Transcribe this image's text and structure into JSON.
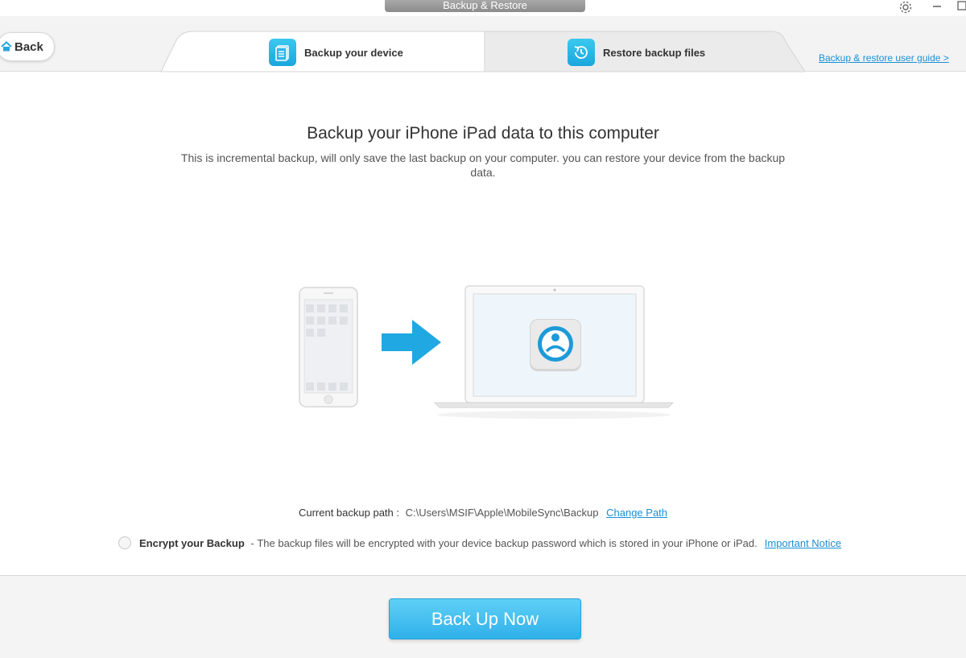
{
  "window": {
    "title": "Backup & Restore"
  },
  "header": {
    "back_label": "Back",
    "tabs": [
      {
        "label": "Backup your device",
        "icon": "backup-document-icon",
        "active": true
      },
      {
        "label": "Restore backup files",
        "icon": "restore-history-icon",
        "active": false
      }
    ],
    "guide_link": "Backup & restore user guide >"
  },
  "main": {
    "title": "Backup your iPhone iPad data to this computer",
    "description": "This is incremental backup, will only save the last backup on your computer. you can restore your device from the backup data."
  },
  "backup_path": {
    "label": "Current backup path :",
    "value": "C:\\Users\\MSIF\\Apple\\MobileSync\\Backup",
    "change_link": "Change Path"
  },
  "encrypt": {
    "label": "Encrypt your Backup",
    "separator": " - ",
    "text": "The backup files will be encrypted with your device backup password which is stored in your iPhone or iPad.",
    "notice_link": "Important Notice",
    "checked": false
  },
  "action": {
    "button_label": "Back Up Now"
  },
  "colors": {
    "accent": "#1a8fd6",
    "button": "#3fbdf0"
  }
}
